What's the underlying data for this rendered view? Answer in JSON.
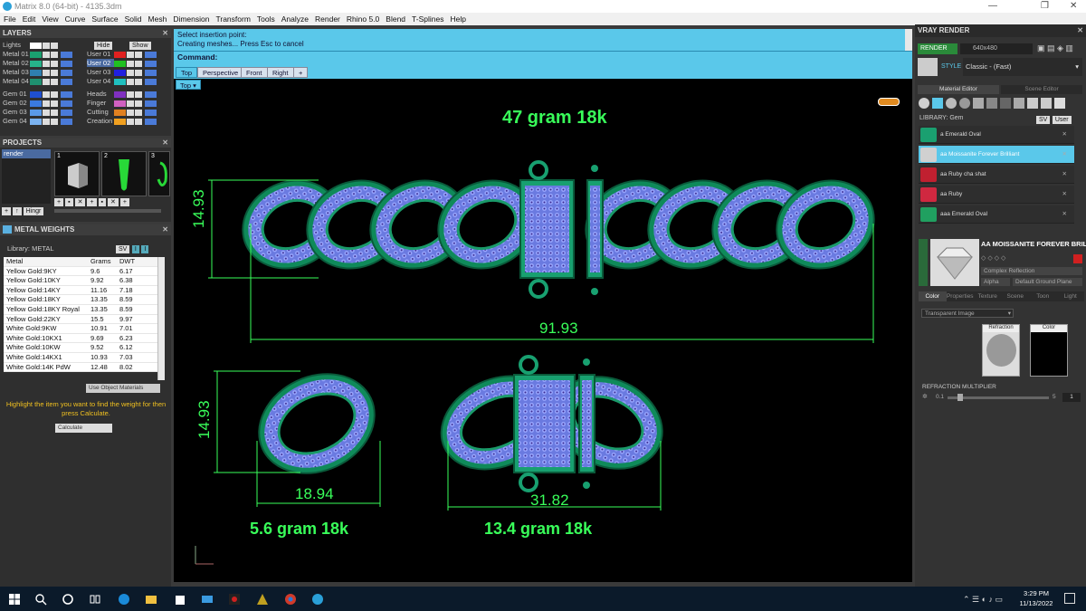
{
  "window": {
    "title": "Matrix 8.0 (64-bit) - 4135.3dm"
  },
  "menu": [
    "File",
    "Edit",
    "View",
    "Curve",
    "Surface",
    "Solid",
    "Mesh",
    "Dimension",
    "Transform",
    "Tools",
    "Analyze",
    "Render",
    "Rhino 5.0",
    "Blend",
    "T-Splines",
    "Help"
  ],
  "layers": {
    "title": "LAYERS",
    "lights": "Lights",
    "hide": "Hide",
    "show": "Show",
    "left": [
      {
        "name": "Metal 01",
        "color": "#1aa070"
      },
      {
        "name": "Metal 02",
        "color": "#26b38a"
      },
      {
        "name": "Metal 03",
        "color": "#2f7fb0"
      },
      {
        "name": "Metal 04",
        "color": "#1f9070"
      },
      {
        "name": "Gem 01",
        "color": "#1f4fd0"
      },
      {
        "name": "Gem 02",
        "color": "#3a7ae0"
      },
      {
        "name": "Gem 03",
        "color": "#5a9ae8"
      },
      {
        "name": "Gem 04",
        "color": "#7ab2f0"
      }
    ],
    "right": [
      {
        "name": "User 01",
        "color": "#e02020"
      },
      {
        "name": "User 02",
        "color": "#20c020"
      },
      {
        "name": "User 03",
        "color": "#2020e0"
      },
      {
        "name": "User 04",
        "color": "#20c0c0"
      },
      {
        "name": "Heads",
        "color": "#8030c0"
      },
      {
        "name": "Finger",
        "color": "#d060c0"
      },
      {
        "name": "Cutting",
        "color": "#e08020"
      },
      {
        "name": "Creation",
        "color": "#f0a020"
      }
    ]
  },
  "projects": {
    "title": "PROJECTS",
    "item": "render",
    "thumbs": [
      "1",
      "2",
      "3"
    ],
    "hinge": "Hingr"
  },
  "metal_weights": {
    "title": "METAL WEIGHTS",
    "library": "Library: METAL",
    "sv": "SV",
    "headers": [
      "Metal",
      "Grams",
      "DWT"
    ],
    "rows": [
      [
        "Yellow Gold:9KY",
        "9.6",
        "6.17"
      ],
      [
        "Yellow Gold:10KY",
        "9.92",
        "6.38"
      ],
      [
        "Yellow Gold:14KY",
        "11.16",
        "7.18"
      ],
      [
        "Yellow Gold:18KY",
        "13.35",
        "8.59"
      ],
      [
        "Yellow Gold:18KY Royal",
        "13.35",
        "8.59"
      ],
      [
        "Yellow Gold:22KY",
        "15.5",
        "9.97"
      ],
      [
        "White Gold:9KW",
        "10.91",
        "7.01"
      ],
      [
        "White Gold:10KX1",
        "9.69",
        "6.23"
      ],
      [
        "White Gold:10KW",
        "9.52",
        "6.12"
      ],
      [
        "White Gold:14KX1",
        "10.93",
        "7.03"
      ],
      [
        "White Gold:14K PdW",
        "12.48",
        "8.02"
      ]
    ],
    "use_obj": "Use Object Materials",
    "hint": "Highlight the item you want to find the weight for then press Calculate.",
    "calculate": "Calculate"
  },
  "command": {
    "line1": "Select insertion point:",
    "line2": "Creating meshes... Press Esc to cancel",
    "prompt": "Command:"
  },
  "tabs": [
    "Top",
    "Perspective",
    "Front",
    "Right",
    "+"
  ],
  "viewport_label": "Top",
  "annotations": {
    "w1": "47 gram 18k",
    "w2": "5.6 gram 18k",
    "w3": "13.4 gram 18k",
    "d_width": "91.93",
    "d_height1": "14.93",
    "d_height2": "14.93",
    "d_link": "18.94",
    "d_clasp": "31.82"
  },
  "vray": {
    "title": "VRAY RENDER",
    "render": "RENDER",
    "res": "640x480",
    "style_label": "STYLE",
    "style": "Classic - (Fast)",
    "tabs": [
      "Material Editor",
      "Scene Editor"
    ],
    "library": "LIBRARY: Gem",
    "sv": "SV",
    "user": "User",
    "materials": [
      {
        "name": "a Emerald Oval",
        "color": "#1aa070"
      },
      {
        "name": "aa Moissanite Forever Brilliant",
        "color": "#d0d0d0"
      },
      {
        "name": "aa Ruby cha shat",
        "color": "#c02030"
      },
      {
        "name": "aa Ruby",
        "color": "#d02840"
      },
      {
        "name": "aaa Emerald Oval",
        "color": "#20a060"
      }
    ],
    "selected_name": "AA MOISSANITE FOREVER BRILLIANT",
    "complex": "Complex Reflection",
    "alpha": "Alpha",
    "ground": "Default Ground Plane",
    "subtabs": [
      "Color",
      "Properties",
      "Texture",
      "Scene",
      "Toon",
      "Light"
    ],
    "transparent": "Transparent Image",
    "refraction": "Refraction",
    "color": "Color",
    "mult_label": "REFRACTION MULTIPLIER",
    "mult_min": "0.1",
    "mult_max": "5",
    "mult_val": "1",
    "mult_fraction": 0.1
  },
  "taskbar": {
    "time": "3:29 PM",
    "date": "11/13/2022"
  }
}
